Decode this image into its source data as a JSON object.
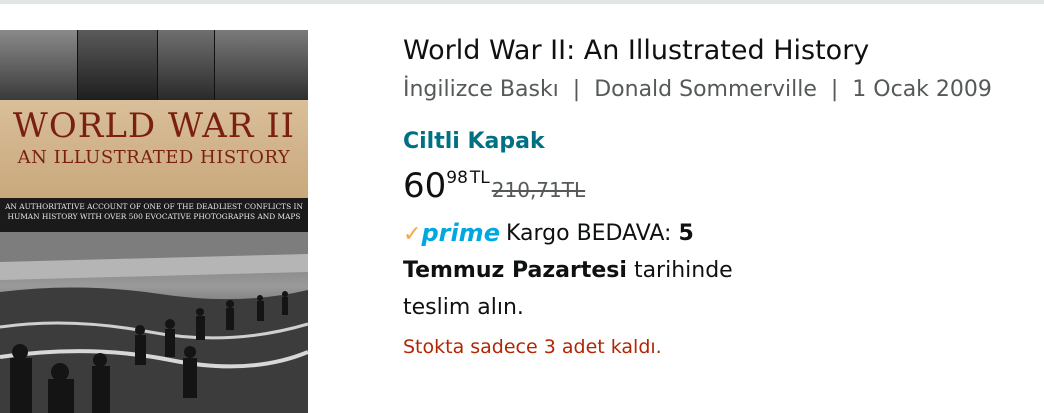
{
  "product": {
    "cover": {
      "title_line1": "WORLD WAR II",
      "title_line2": "AN ILLUSTRATED HISTORY",
      "blurb": "An authoritative account of one of the deadliest conflicts in human history with over 500 evocative photographs and maps"
    },
    "title": "World War II: An Illustrated History",
    "meta": {
      "language": "İngilizce Baskı",
      "author": "Donald Sommerville",
      "date": "1 Ocak 2009",
      "separator": "|"
    },
    "binding": "Ciltli Kapak",
    "price": {
      "whole": "60",
      "fraction": "98",
      "currency": "TL",
      "old_price": "210,71TL"
    },
    "delivery": {
      "prime_word": "prime",
      "prime_check": "✓",
      "shipping_text": "Kargo BEDAVA:",
      "day_number": "5",
      "day_name": "Temmuz Pazartesi",
      "suffix": "tarihinde",
      "line3": "teslim alın."
    },
    "stock": "Stokta sadece 3 adet kaldı."
  },
  "colors": {
    "link_teal": "#007185",
    "stock_red": "#b12704",
    "prime_blue": "#00a8e1",
    "prime_orange": "#f3a847",
    "secondary_text": "#565959"
  }
}
